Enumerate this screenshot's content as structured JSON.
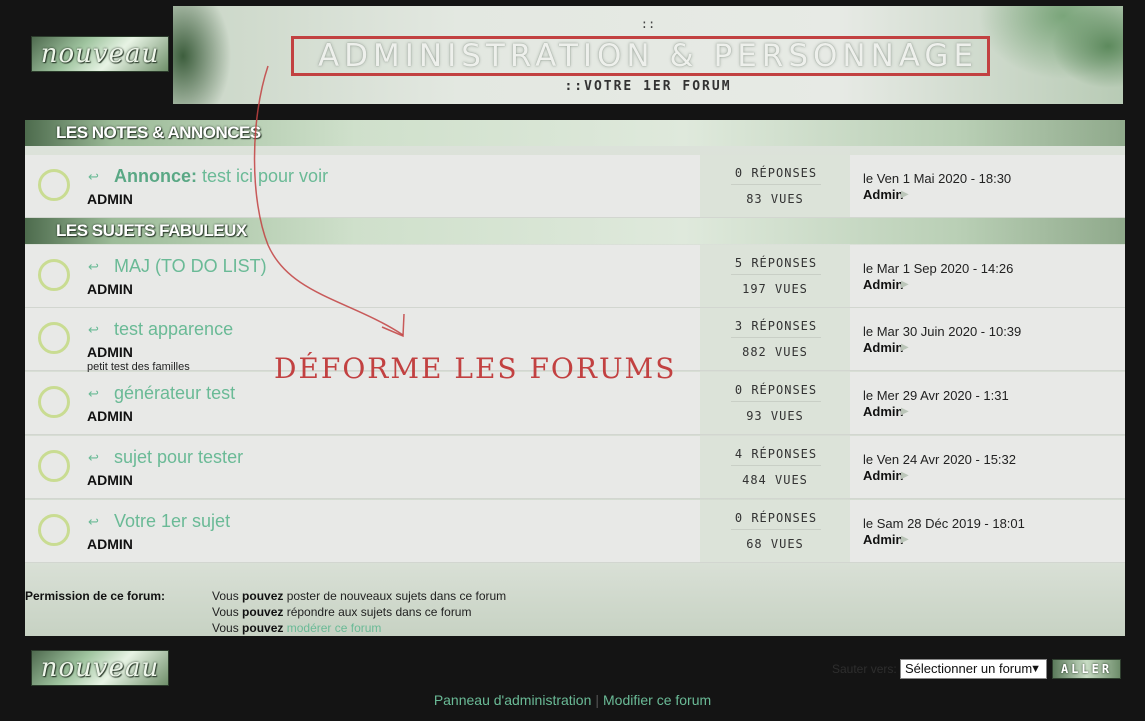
{
  "new_button_label": "nouveau",
  "banner": {
    "dots": "::",
    "title": "ADMINISTRATION & PERSONNAGE",
    "subtitle": "::VOTRE 1ER FORUM"
  },
  "annotation": {
    "text": "DÉFORME LES FORUMS",
    "color": "#c24141"
  },
  "categories": [
    {
      "title": "LES NOTES & ANNONCES",
      "topics": [
        {
          "prefix": "Annonce:",
          "title": "test ici pour voir",
          "author": "ADMIN",
          "desc": "",
          "replies": "0 RÉPONSES",
          "views": "83 VUES",
          "last_date": "le Ven 1 Mai 2020 - 18:30",
          "last_author": "Admin"
        }
      ]
    },
    {
      "title": "LES SUJETS FABULEUX",
      "topics": [
        {
          "prefix": "",
          "title": "MAJ (TO DO LIST)",
          "author": "ADMIN",
          "desc": "",
          "replies": "5 RÉPONSES",
          "views": "197 VUES",
          "last_date": "le Mar 1 Sep 2020 - 14:26",
          "last_author": "Admin"
        },
        {
          "prefix": "",
          "title": "test apparence",
          "author": "ADMIN",
          "desc": "petit test des familles",
          "replies": "3 RÉPONSES",
          "views": "882 VUES",
          "last_date": "le Mar 30 Juin 2020 - 10:39",
          "last_author": "Admin"
        },
        {
          "prefix": "",
          "title": "générateur test",
          "author": "ADMIN",
          "desc": "",
          "replies": "0 RÉPONSES",
          "views": "93 VUES",
          "last_date": "le Mer 29 Avr 2020 - 1:31",
          "last_author": "Admin"
        },
        {
          "prefix": "",
          "title": "sujet pour tester",
          "author": "ADMIN",
          "desc": "",
          "replies": "4 RÉPONSES",
          "views": "484 VUES",
          "last_date": "le Ven 24 Avr 2020 - 15:32",
          "last_author": "Admin"
        },
        {
          "prefix": "",
          "title": "Votre 1er sujet",
          "author": "ADMIN",
          "desc": "",
          "replies": "0 RÉPONSES",
          "views": "68 VUES",
          "last_date": "le Sam 28 Déc 2019 - 18:01",
          "last_author": "Admin"
        }
      ]
    }
  ],
  "permissions": {
    "label": "Permission de ce forum:",
    "lines": [
      {
        "pre": "Vous ",
        "bold": "pouvez",
        "post": " poster de nouveaux sujets dans ce forum",
        "link": ""
      },
      {
        "pre": "Vous ",
        "bold": "pouvez",
        "post": " répondre aux sujets dans ce forum",
        "link": ""
      },
      {
        "pre": "Vous ",
        "bold": "pouvez",
        "post": " ",
        "link": "modérer ce forum"
      }
    ]
  },
  "jump": {
    "label": "Sauter vers:",
    "selected": "Sélectionner un forum",
    "go": "ALLER"
  },
  "bottom_links": {
    "admin": "Panneau d'administration",
    "sep": "|",
    "edit": "Modifier ce forum"
  },
  "colors": {
    "accent": "#6aba96",
    "circle": "#c9dc92",
    "annotation": "#c24141",
    "background": "#141414"
  }
}
